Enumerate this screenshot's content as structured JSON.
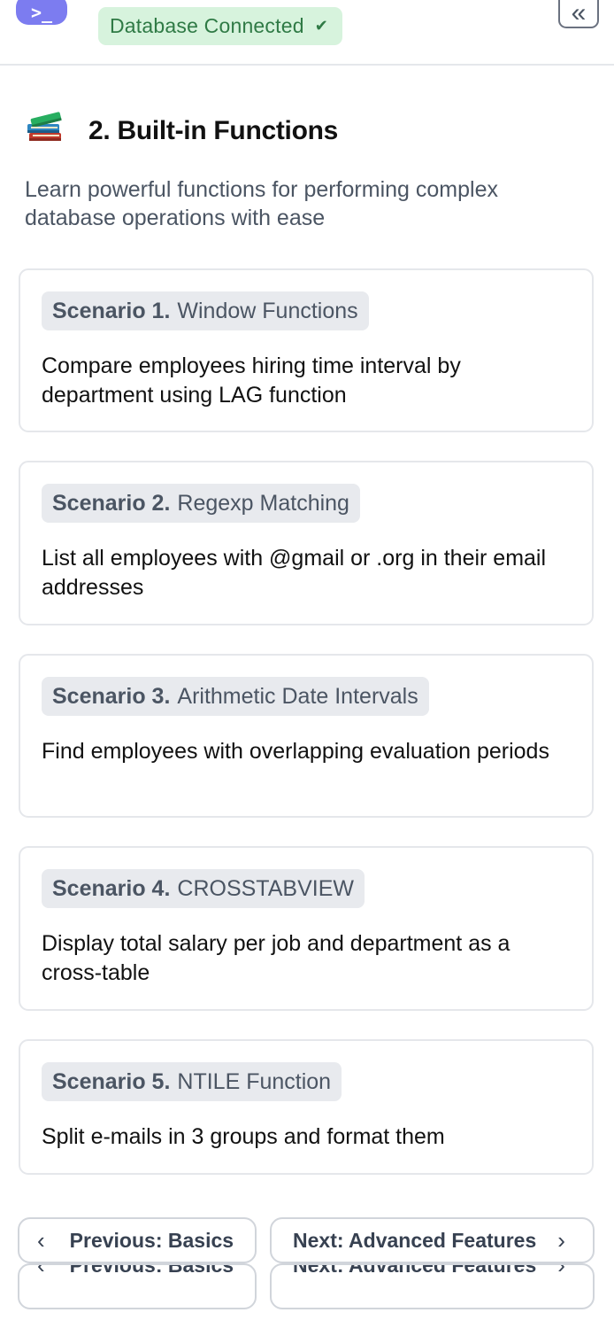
{
  "header": {
    "logo_glyph": ">_",
    "status_text": "Database Connected",
    "status_icon": "check-icon",
    "collapse_icon": "chevron-double-left-icon",
    "collapse_glyph": "«"
  },
  "section": {
    "icon": "books-icon",
    "title": "2. Built-in Functions",
    "subtitle": "Learn powerful functions for performing complex database operations with ease"
  },
  "scenarios": [
    {
      "number": "Scenario 1.",
      "name": "Window Functions",
      "description": "Compare employees hiring time interval by department using LAG function"
    },
    {
      "number": "Scenario 2.",
      "name": "Regexp Matching",
      "description": "List all employees with @gmail or .org in their email addresses"
    },
    {
      "number": "Scenario 3.",
      "name": "Arithmetic Date Intervals",
      "description": "Find employees with overlapping evaluation periods"
    },
    {
      "number": "Scenario 4.",
      "name": "CROSSTABVIEW",
      "description": "Display total salary per job and department as a cross-table"
    },
    {
      "number": "Scenario 5.",
      "name": "NTILE Function",
      "description": "Split e-mails in 3 groups and format them"
    }
  ],
  "navigation": {
    "previous_label": "Previous: Basics",
    "next_label": "Next: Advanced Features",
    "previous_icon": "chevron-left-icon",
    "next_icon": "chevron-right-icon"
  },
  "colors": {
    "accent": "#7c7cf0",
    "status_bg": "#d7f3dd",
    "status_text": "#2f7a45",
    "tag_bg": "#e8eaee",
    "border": "#e5e7eb"
  }
}
